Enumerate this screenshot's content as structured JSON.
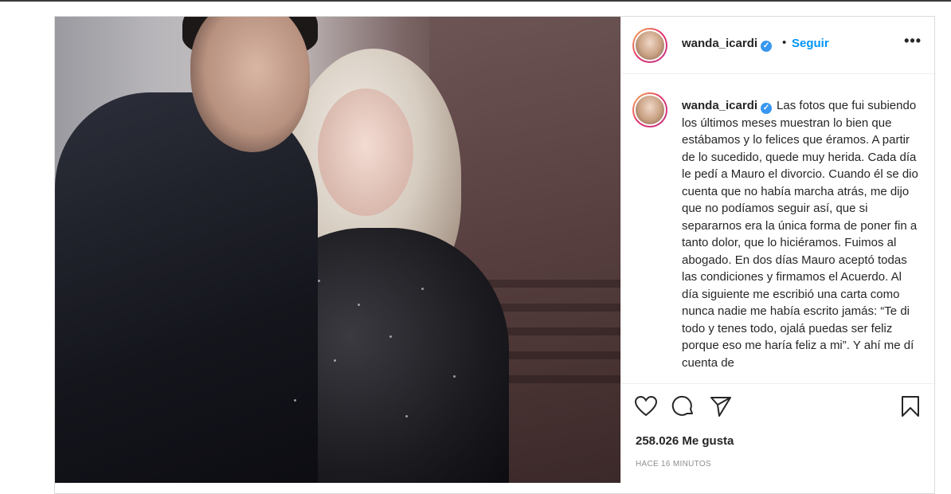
{
  "post": {
    "username": "wanda_icardi",
    "verified_mark": "✓",
    "separator": "•",
    "follow_label": "Seguir",
    "more_label": "•••",
    "caption_username": "wanda_icardi",
    "caption_text": "Las fotos que fui subiendo los últimos meses muestran lo bien que estábamos y lo felices que éramos. A partir de lo sucedido, quede muy herida. Cada día le pedí a Mauro el divorcio. Cuando él se dio cuenta que no había marcha atrás, me dijo que no podíamos seguir así, que si separarnos era la única forma de poner fin a tanto dolor, que lo hiciéramos. Fuimos al abogado. En dos días Mauro aceptó todas las condiciones y firmamos el Acuerdo. Al día siguiente me escribió una carta como nunca nadie me había escrito jamás: “Te di todo y tenes todo, ojalá puedas ser feliz porque eso me haría feliz a mi”. Y ahí me dí cuenta de",
    "likes": "258.026 Me gusta",
    "timestamp": "HACE 16 MINUTOS"
  },
  "icons": {
    "like": "heart-icon",
    "comment": "comment-icon",
    "share": "paper-plane-icon",
    "save": "bookmark-icon",
    "verified": "verified-badge-icon"
  },
  "colors": {
    "follow": "#0095f6",
    "verified": "#3897f0",
    "border": "#dbdbdb",
    "muted": "#8e8e8e"
  }
}
